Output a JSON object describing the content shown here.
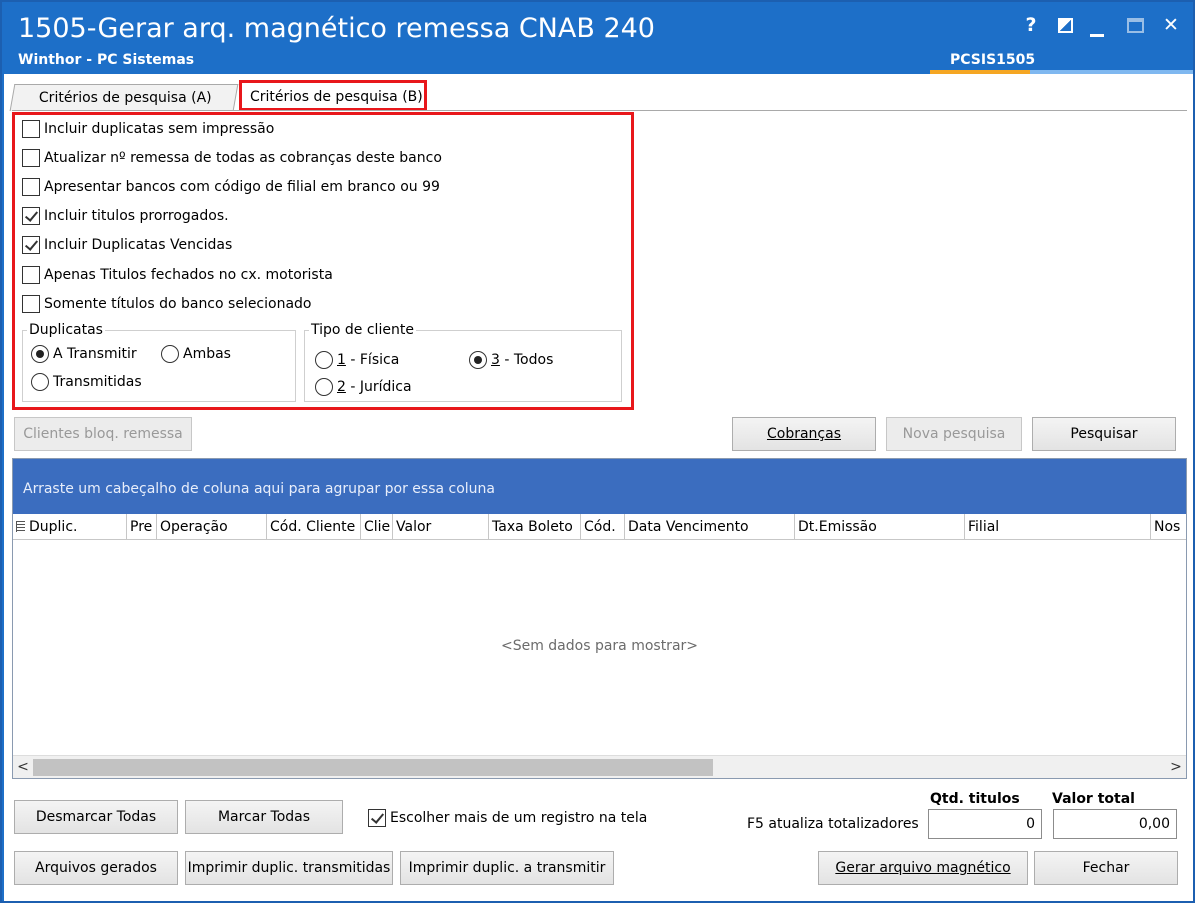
{
  "window": {
    "title": "1505-Gerar arq. magnético remessa CNAB 240",
    "subtitle": "Winthor - PC Sistemas",
    "code": "PCSIS1505",
    "help_glyph": "?",
    "close_glyph": "✕"
  },
  "tabs": [
    {
      "label": "Critérios de pesquisa (A)",
      "active": false
    },
    {
      "label": "Critérios de pesquisa (B)",
      "active": true
    }
  ],
  "options": [
    {
      "label": "Incluir duplicatas sem impressão",
      "checked": false
    },
    {
      "label": "Atualizar nº remessa de todas as cobranças deste banco",
      "checked": false
    },
    {
      "label": "Apresentar bancos com código de filial em branco ou 99",
      "checked": false
    },
    {
      "label": "Incluir titulos prorrogados.",
      "checked": true
    },
    {
      "label": "Incluir Duplicatas Vencidas",
      "checked": true
    },
    {
      "label": "Apenas Titulos fechados no cx. motorista",
      "checked": false
    },
    {
      "label": "Somente títulos do banco selecionado",
      "checked": false
    }
  ],
  "duplicatas": {
    "title": "Duplicatas",
    "options": [
      {
        "label": "A Transmitir",
        "selected": true
      },
      {
        "label": "Ambas",
        "selected": false
      },
      {
        "label": "Transmitidas",
        "selected": false
      }
    ]
  },
  "tipo_cliente": {
    "title": "Tipo de cliente",
    "options": [
      {
        "key": "1",
        "label": " - Física",
        "selected": false
      },
      {
        "key": "3",
        "label": " - Todos",
        "selected": true
      },
      {
        "key": "2",
        "label": " - Jurídica",
        "selected": false
      }
    ]
  },
  "buttons": {
    "clientes_bloq": "Clientes bloq. remessa",
    "cobrancas": "Cobranças",
    "nova_pesquisa": "Nova pesquisa",
    "pesquisar": "Pesquisar",
    "desmarcar_todas": "Desmarcar Todas",
    "marcar_todas": "Marcar Todas",
    "arquivos_gerados": "Arquivos gerados",
    "imprimir_transmitidas": "Imprimir duplic. transmitidas",
    "imprimir_a_transmitir": "Imprimir duplic. a transmitir",
    "gerar_arquivo": "Gerar arquivo magnético",
    "fechar": "Fechar"
  },
  "grid": {
    "group_hint": "Arraste um cabeçalho de coluna aqui para agrupar por essa coluna",
    "columns": [
      "Duplic.",
      "Pre",
      "Operação",
      "Cód. Cliente",
      "Clie",
      "Valor",
      "Taxa Boleto",
      "Cód.",
      "Data Vencimento",
      "Dt.Emissão",
      "Filial",
      "Nos"
    ],
    "empty_text": "<Sem dados para mostrar>",
    "scroll_left": "<",
    "scroll_right": ">"
  },
  "footer": {
    "multi_select_label": "Escolher mais de um registro na tela",
    "multi_select_checked": true,
    "f5_label": "F5 atualiza totalizadores",
    "qtd_label": "Qtd. titulos",
    "qtd_value": "0",
    "valor_label": "Valor total",
    "valor_value": "0,00"
  }
}
